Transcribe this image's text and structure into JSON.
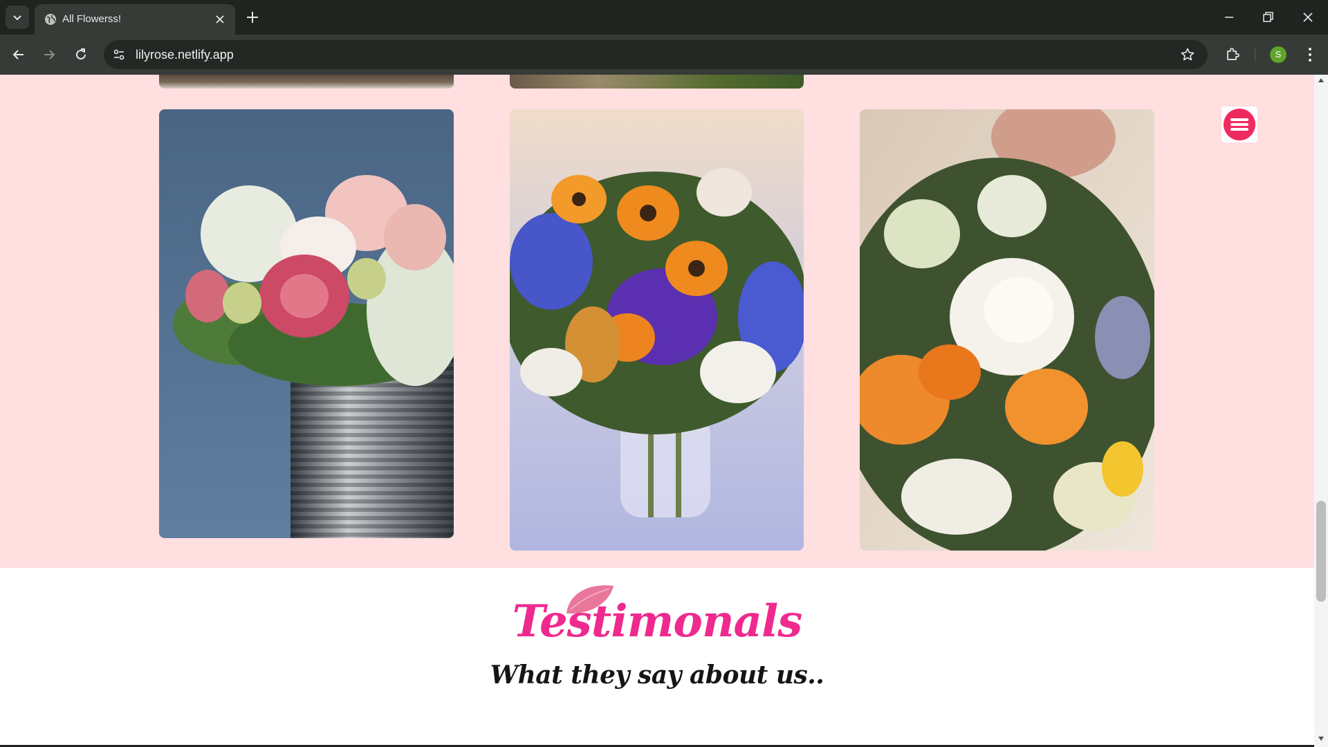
{
  "browser": {
    "tab_title": "All Flowerss!",
    "url": "lilyrose.netlify.app",
    "profile_initial": "S",
    "icons": {
      "tab_list": "chevron-down-icon",
      "favicon": "globe-icon",
      "close_tab": "close-icon",
      "new_tab": "plus-icon",
      "back": "arrow-left-icon",
      "forward": "arrow-right-icon",
      "reload": "reload-icon",
      "site_info": "tune-icon",
      "bookmark": "star-icon",
      "extensions": "puzzle-icon",
      "menu": "more-vertical-icon"
    }
  },
  "page": {
    "colors": {
      "gallery_bg": "#ffdfe0",
      "accent": "#ef2a8f",
      "heading_dark": "#151515"
    },
    "gallery": {
      "photos": [
        {
          "subject": "Pink ranunculus and roses in a tin can"
        },
        {
          "subject": "Orange daisies and purple flowers in a glass vase"
        },
        {
          "subject": "White peony bouquet with orange tulips"
        }
      ]
    },
    "menu_button_icon": "hamburger-icon",
    "testimonials": {
      "heading": "Testimonals",
      "subheading": "What they say about us.."
    }
  }
}
